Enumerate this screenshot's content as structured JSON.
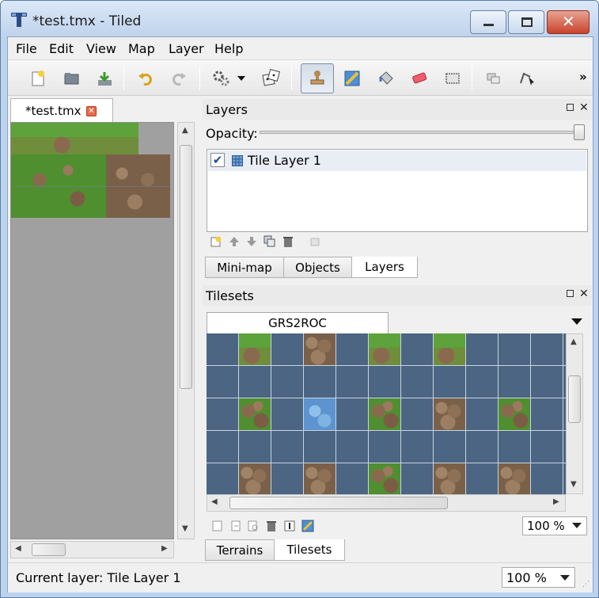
{
  "window": {
    "title": "*test.tmx - Tiled",
    "app_icon": "tiled-logo-icon",
    "caption_buttons": [
      "minimize-icon",
      "maximize-icon",
      "close-icon"
    ]
  },
  "menubar": {
    "items": [
      {
        "label": "File",
        "mnemonic": "F"
      },
      {
        "label": "Edit",
        "mnemonic": "E"
      },
      {
        "label": "View",
        "mnemonic": "V"
      },
      {
        "label": "Map",
        "mnemonic": "M"
      },
      {
        "label": "Layer",
        "mnemonic": "L"
      },
      {
        "label": "Help",
        "mnemonic": "H"
      }
    ]
  },
  "toolbar": {
    "buttons": [
      "new-map-icon",
      "open-file-icon",
      "save-file-icon",
      "undo-icon",
      "redo-icon",
      "commands-gears-icon",
      "dropdown-arrow-icon",
      "random-dice-icon",
      "stamp-brush-icon",
      "terrain-brush-icon",
      "bucket-fill-icon",
      "eraser-icon",
      "rectangular-select-icon",
      "select-same-tile-icon",
      "edit-polygon-icon"
    ],
    "overflow": "»",
    "active_tool": "stamp-brush-icon"
  },
  "document": {
    "tab_label": "*test.tmx",
    "close_icon": "tab-close-icon"
  },
  "layers_panel": {
    "title": "Layers",
    "opacity_label": "Opacity:",
    "opacity_value": 1.0,
    "layers": [
      {
        "name": "Tile Layer 1",
        "visible": true,
        "icon": "tile-layer-icon"
      }
    ],
    "footer_buttons": [
      "add-layer-icon",
      "move-layer-up-icon",
      "move-layer-down-icon",
      "duplicate-layer-icon",
      "delete-layer-icon",
      "layer-properties-icon"
    ]
  },
  "dock_tabs_top": {
    "tabs": [
      "Mini-map",
      "Objects",
      "Layers"
    ],
    "active": "Layers"
  },
  "tilesets_panel": {
    "title": "Tilesets",
    "tileset_tab": "GRS2ROC",
    "zoom": "100 %",
    "footer_buttons": [
      "new-tileset-icon",
      "import-tileset-icon",
      "export-tileset-icon",
      "delete-tileset-icon",
      "tileset-properties-icon",
      "edit-terrain-icon"
    ]
  },
  "dock_tabs_bottom": {
    "tabs": [
      "Terrains",
      "Tilesets"
    ],
    "active": "Tilesets"
  },
  "statusbar": {
    "current_layer": "Current layer: Tile Layer 1",
    "zoom": "100 %"
  }
}
